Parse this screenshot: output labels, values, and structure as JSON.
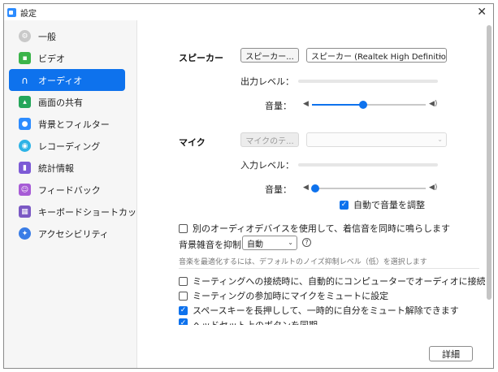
{
  "window": {
    "title": "設定"
  },
  "sidebar": {
    "items": [
      {
        "label": "一般",
        "icon": "general-icon",
        "active": false
      },
      {
        "label": "ビデオ",
        "icon": "video-icon",
        "active": false
      },
      {
        "label": "オーディオ",
        "icon": "headphones-icon",
        "active": true
      },
      {
        "label": "画面の共有",
        "icon": "screen-share-icon",
        "active": false
      },
      {
        "label": "背景とフィルター",
        "icon": "background-icon",
        "active": false
      },
      {
        "label": "レコーディング",
        "icon": "recording-icon",
        "active": false
      },
      {
        "label": "統計情報",
        "icon": "statistics-icon",
        "active": false
      },
      {
        "label": "フィードバック",
        "icon": "feedback-icon",
        "active": false
      },
      {
        "label": "キーボードショートカット",
        "icon": "keyboard-icon",
        "active": false
      },
      {
        "label": "アクセシビリティ",
        "icon": "accessibility-icon",
        "active": false
      }
    ]
  },
  "speaker": {
    "label": "スピーカー",
    "test_button": "スピーカー...",
    "device": "スピーカー (Realtek High Definitio...",
    "output_level_label": "出力レベル：",
    "volume_label": "音量：",
    "volume_level": 0.45
  },
  "mic": {
    "label": "マイク",
    "test_button": "マイクのテ...",
    "device": "",
    "input_level_label": "入力レベル：",
    "volume_label": "音量：",
    "volume_level": 0.03,
    "auto_adjust": {
      "label": "自動で音量を調整",
      "checked": true
    }
  },
  "options": {
    "separate_device": {
      "label": "別のオーディオデバイスを使用して、着信音を同時に鳴らします",
      "checked": false
    },
    "noise_label": "背景雑音を抑制",
    "noise_value": "自動",
    "noise_note": "音楽を最適化するには、デフォルトのノイズ抑制レベル（低）を選択します",
    "auto_join": {
      "label": "ミーティングへの接続時に、自動的にコンピューターでオーディオに接続",
      "checked": false
    },
    "mute_mic": {
      "label": "ミーティングの参加時にマイクをミュートに設定",
      "checked": false
    },
    "space_unmute": {
      "label": "スペースキーを長押しして、一時的に自分をミュート解除できます",
      "checked": true
    },
    "headset": {
      "label": "ヘッドセット上のボタンを同期",
      "checked": true
    }
  },
  "footer": {
    "advanced_button": "詳細"
  },
  "colors": {
    "accent": "#0e72ed"
  }
}
